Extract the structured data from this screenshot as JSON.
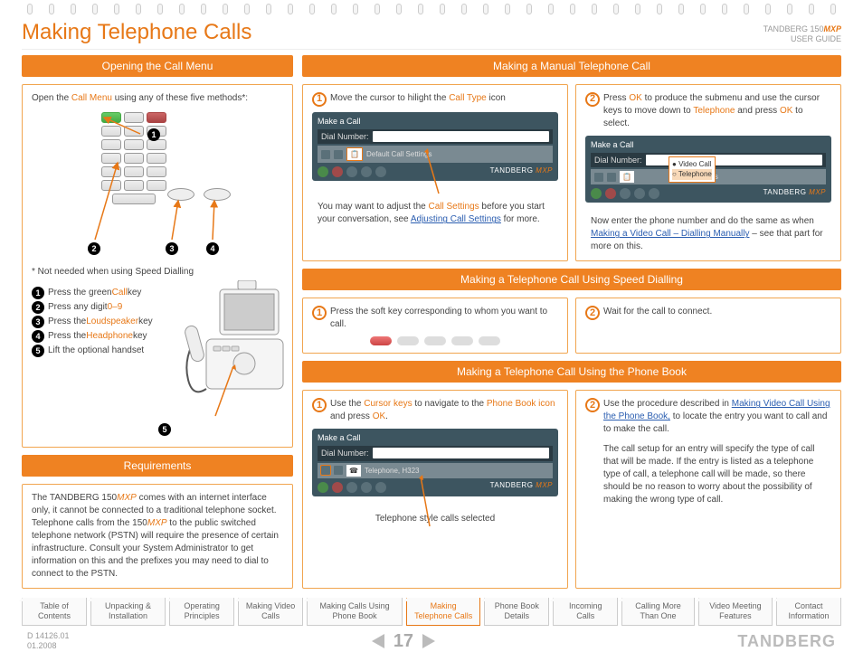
{
  "header": {
    "title": "Making Telephone Calls",
    "product": "TANDBERG 150",
    "product_suffix": "MXP",
    "guide": "USER GUIDE"
  },
  "left": {
    "open_hdr": "Opening the Call Menu",
    "open_text_a": "Open the ",
    "open_text_b": "Call Menu",
    "open_text_c": " using any of these five methods*:",
    "note": "* Not needed when using Speed Dialling",
    "legend": {
      "l1a": "Press the green ",
      "l1b": "Call",
      "l1c": " key",
      "l2a": "Press any digit ",
      "l2b": "0–9",
      "l3a": "Press the ",
      "l3b": "Loudspeaker",
      "l3c": " key",
      "l4a": "Press the ",
      "l4b": "Headphone",
      "l4c": " key",
      "l5": "Lift the optional handset"
    },
    "req_hdr": "Requirements",
    "req_a": "The TANDBERG 150",
    "req_b": "MXP",
    "req_c": " comes with an internet interface only, it cannot be connected to a traditional telephone socket. Telephone calls from the 150",
    "req_d": "MXP",
    "req_e": " to the public switched telephone network (PSTN) will require the presence of certain infrastructure. Consult your System Administrator to get information on this and the prefixes you may need to dial to connect to the PSTN."
  },
  "right": {
    "manual_hdr": "Making a Manual Telephone Call",
    "s1a": "Move the cursor to hilight the ",
    "s1b": "Call Type",
    "s1c": " icon",
    "s1_note_a": "You may want to adjust the ",
    "s1_note_b": "Call Settings",
    "s1_note_c": " before you start your conversation, see ",
    "s1_note_link": "Adjusting Call Settings",
    "s1_note_d": " for more.",
    "s2a": "Press ",
    "s2b": "OK",
    "s2c": " to produce the submenu and use the cursor keys to move down to ",
    "s2d": "Telephone",
    "s2e": " and press ",
    "s2f": "OK",
    "s2g": " to select.",
    "s2_note_a": "Now enter the phone number and do the same as when ",
    "s2_note_link": "Making a Video Call – Dialling Manually",
    "s2_note_b": " – see that part for more on this.",
    "speed_hdr": "Making a Telephone Call Using Speed Dialling",
    "sp1": "Press the soft key corresponding to whom you want to call.",
    "sp2": "Wait for the call to connect.",
    "pb_hdr": "Making a Telephone Call Using the Phone Book",
    "pb1a": "Use the ",
    "pb1b": "Cursor keys",
    "pb1c": " to navigate to the ",
    "pb1d": "Phone Book icon",
    "pb1e": " and press ",
    "pb1f": "OK",
    "pb1g": ".",
    "pb1_cap": "Telephone style calls selected",
    "pb2a": "Use the procedure described in ",
    "pb2link": "Making Video Call Using the Phone Book,",
    "pb2b": " to locate the entry you want to call and to make the call.",
    "pb2c": "The call setup for an entry will specify the type of call that will be made. If the entry is listed as a telephone type of call, a telephone call will be made, so there should be no reason to worry about the possibility of making the wrong type of call."
  },
  "screen": {
    "make": "Make a Call",
    "dial": "Dial Number:",
    "dcs": "Default Call Settings",
    "settings": "Settings",
    "vc": "Video Call",
    "tp": "Telephone",
    "th": "Telephone, H323",
    "brand": "TANDBERG",
    "brand_sfx": "MXP"
  },
  "tabs": {
    "t1": "Table of Contents",
    "t2": "Unpacking & Installation",
    "t3": "Operating Principles",
    "t4": "Making Video Calls",
    "t5": "Making Calls Using Phone Book",
    "t6": "Making Telephone Calls",
    "t7": "Phone Book Details",
    "t8": "Incoming Calls",
    "t9": "Calling More Than One",
    "t10": "Video Meeting Features",
    "t11": "Contact Information"
  },
  "footer": {
    "doc1": "D 14126.01",
    "doc2": "01.2008",
    "page": "17",
    "brand": "TANDBERG"
  }
}
